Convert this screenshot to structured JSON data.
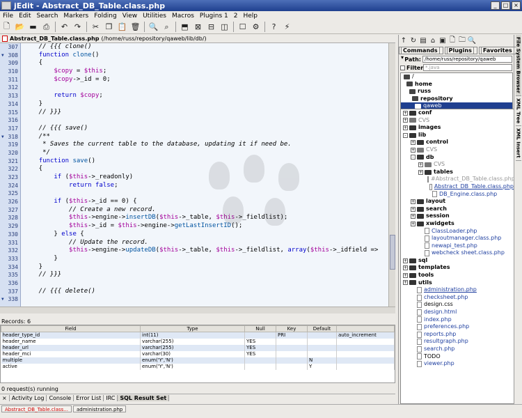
{
  "window": {
    "title": "jEdit - Abstract_DB_Table.class.php"
  },
  "menu": [
    "File",
    "Edit",
    "Search",
    "Markers",
    "Folding",
    "View",
    "Utilities",
    "Macros",
    "Plugins 1",
    "2",
    "Help"
  ],
  "toolbar_icons": [
    "new-file-icon",
    "open-file-icon",
    "save-icon",
    "print-icon",
    "close-icon",
    "undo-icon",
    "redo-icon",
    "cut-icon",
    "copy-icon",
    "paste-icon",
    "trash-icon",
    "find-icon",
    "find-next-icon",
    "split-horizontal-icon",
    "unsplit-icon",
    "split-vertical-icon",
    "split-cols-icon",
    "buffer-options-icon",
    "plugin-manager-icon",
    "help-icon",
    "run-icon"
  ],
  "buffer": {
    "name": "Abstract_DB_Table.class.php",
    "path": "(/home/russ/repository/qaweb/lib/db/)"
  },
  "editor": {
    "line_numbers": [
      "307",
      "308",
      "309",
      "310",
      "311",
      "312",
      "313",
      "314",
      "315",
      "316",
      "317",
      "318",
      "319",
      "320",
      "321",
      "322",
      "323",
      "324",
      "325",
      "326",
      "327",
      "328",
      "329",
      "330",
      "331",
      "332",
      "333",
      "334",
      "335",
      "336",
      "337",
      "338"
    ],
    "fold_lines": [
      "308",
      "318",
      "338"
    ]
  },
  "results": {
    "label": "Records: 6",
    "headers": [
      "Field",
      "Type",
      "Null",
      "Key",
      "Default",
      ""
    ],
    "rows": [
      [
        "header_type_id",
        "int(11)",
        "",
        "PRI",
        "",
        "auto_increment"
      ],
      [
        "header_name",
        "varchar(255)",
        "YES",
        "",
        "",
        ""
      ],
      [
        "header_url",
        "varchar(255)",
        "YES",
        "",
        "",
        ""
      ],
      [
        "header_mci",
        "varchar(30)",
        "YES",
        "",
        "",
        ""
      ],
      [
        "multiple",
        "enum('Y','N')",
        "",
        "",
        "N",
        ""
      ],
      [
        "active",
        "enum('Y','N')",
        "",
        "",
        "Y",
        ""
      ]
    ]
  },
  "status": {
    "requests": "0 request(s) running"
  },
  "dock_tabs": [
    "Activity Log",
    "Console",
    "Error List",
    "IRC",
    "SQL Result Set"
  ],
  "open_buffers": [
    "Abstract_DB_Table.class...",
    "administration.php"
  ],
  "file_browser": {
    "menus": [
      "Commands",
      "Plugins",
      "Favorites"
    ],
    "path_label": "Path:",
    "path_value": "/home/russ/repository/qaweb",
    "filter_label": "Filter:",
    "filter_placeholder": "*.java",
    "parents": [
      "/",
      "home",
      "russ",
      "repository",
      "qaweb"
    ],
    "tree": [
      {
        "indent": 0,
        "exp": "+",
        "kind": "dir",
        "name": "conf"
      },
      {
        "indent": 0,
        "exp": "+",
        "kind": "cvs",
        "name": "CVS"
      },
      {
        "indent": 0,
        "exp": "+",
        "kind": "dir",
        "name": "images"
      },
      {
        "indent": 0,
        "exp": "-",
        "kind": "dir",
        "name": "lib"
      },
      {
        "indent": 1,
        "exp": "+",
        "kind": "dir",
        "name": "control"
      },
      {
        "indent": 1,
        "exp": "+",
        "kind": "cvs",
        "name": "CVS"
      },
      {
        "indent": 1,
        "exp": "-",
        "kind": "dir",
        "name": "db"
      },
      {
        "indent": 2,
        "exp": "+",
        "kind": "cvs",
        "name": "CVS"
      },
      {
        "indent": 2,
        "exp": "+",
        "kind": "dir",
        "name": "tables"
      },
      {
        "indent": 3,
        "exp": "",
        "kind": "ghost",
        "name": "#Abstract_DB_Table.class.php#"
      },
      {
        "indent": 3,
        "exp": "",
        "kind": "hl",
        "name": "Abstract_DB_Table.class.php"
      },
      {
        "indent": 3,
        "exp": "",
        "kind": "php",
        "name": "DB_Engine.class.php"
      },
      {
        "indent": 1,
        "exp": "+",
        "kind": "dir",
        "name": "layout"
      },
      {
        "indent": 1,
        "exp": "+",
        "kind": "dir",
        "name": "search"
      },
      {
        "indent": 1,
        "exp": "+",
        "kind": "dir",
        "name": "session"
      },
      {
        "indent": 1,
        "exp": "+",
        "kind": "dir",
        "name": "xwidgets"
      },
      {
        "indent": 2,
        "exp": "",
        "kind": "php",
        "name": "ClassLoader.php"
      },
      {
        "indent": 2,
        "exp": "",
        "kind": "php",
        "name": "layoutmanager.class.php"
      },
      {
        "indent": 2,
        "exp": "",
        "kind": "php",
        "name": "newapi_test.php"
      },
      {
        "indent": 2,
        "exp": "",
        "kind": "php",
        "name": "webcheck sheet.class.php"
      },
      {
        "indent": 0,
        "exp": "+",
        "kind": "dir",
        "name": "sql"
      },
      {
        "indent": 0,
        "exp": "+",
        "kind": "dir",
        "name": "templates"
      },
      {
        "indent": 0,
        "exp": "+",
        "kind": "dir",
        "name": "tools"
      },
      {
        "indent": 0,
        "exp": "+",
        "kind": "dir",
        "name": "utils"
      },
      {
        "indent": 1,
        "exp": "",
        "kind": "hl",
        "name": "administration.php"
      },
      {
        "indent": 1,
        "exp": "",
        "kind": "php",
        "name": "checksheet.php"
      },
      {
        "indent": 1,
        "exp": "",
        "kind": "plain",
        "name": "design.css"
      },
      {
        "indent": 1,
        "exp": "",
        "kind": "php",
        "name": "design.html"
      },
      {
        "indent": 1,
        "exp": "",
        "kind": "php",
        "name": "index.php"
      },
      {
        "indent": 1,
        "exp": "",
        "kind": "php",
        "name": "preferences.php"
      },
      {
        "indent": 1,
        "exp": "",
        "kind": "php",
        "name": "reports.php"
      },
      {
        "indent": 1,
        "exp": "",
        "kind": "php",
        "name": "resultgraph.php"
      },
      {
        "indent": 1,
        "exp": "",
        "kind": "php",
        "name": "search.php"
      },
      {
        "indent": 1,
        "exp": "",
        "kind": "plain",
        "name": "TODO"
      },
      {
        "indent": 1,
        "exp": "",
        "kind": "php",
        "name": "viewer.php"
      }
    ]
  },
  "side_tabs": [
    "File System Browser",
    "XML Tree",
    "XML Insert"
  ]
}
